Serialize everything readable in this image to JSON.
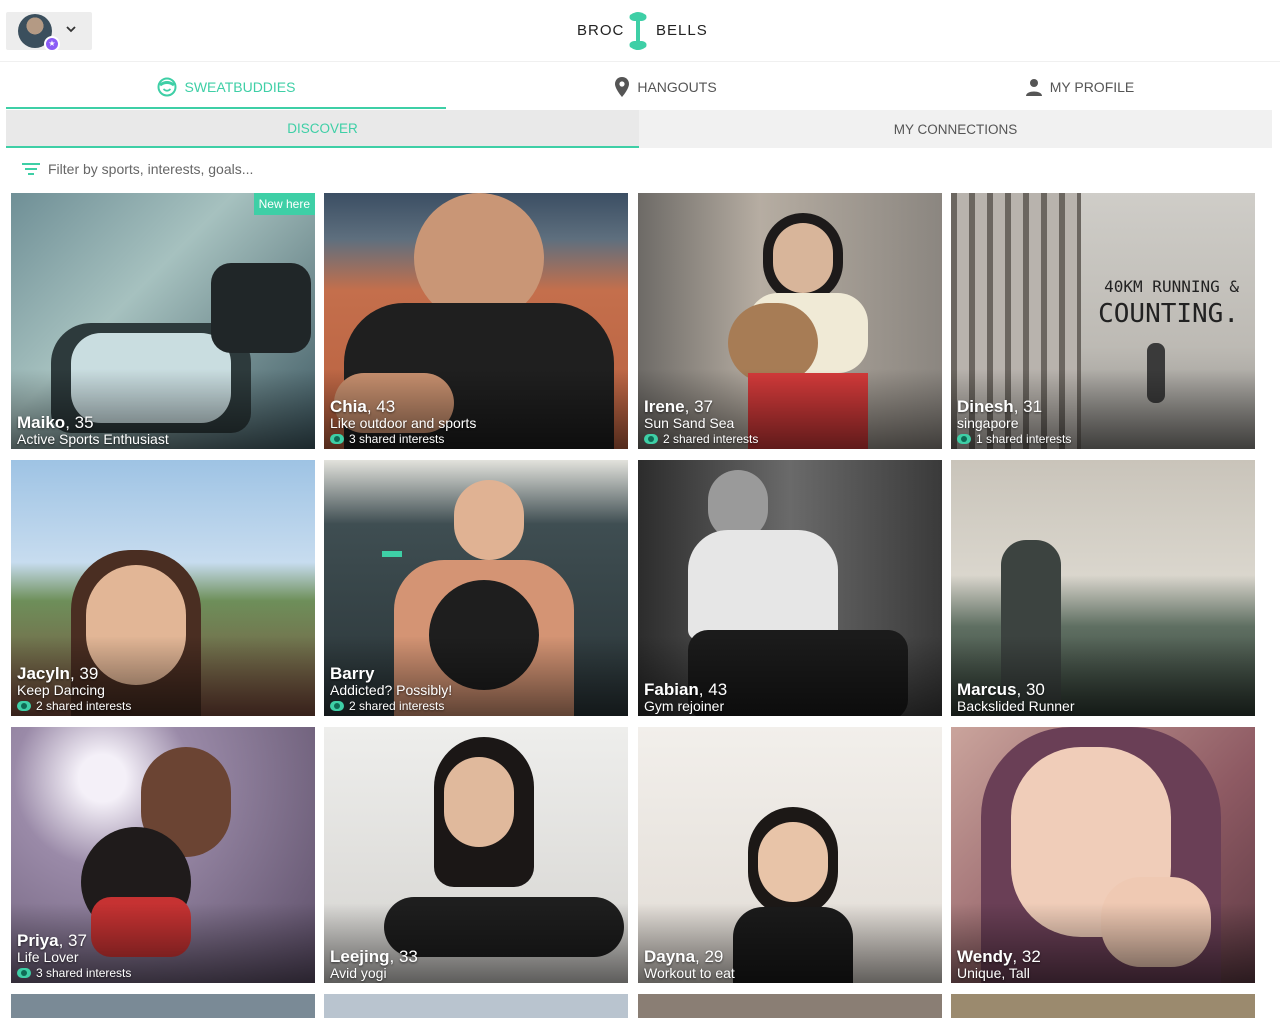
{
  "brand": {
    "left": "BROC",
    "right": "BELLS",
    "accent": "#3ecfa6"
  },
  "header": {
    "avatar_icon": "user-avatar",
    "menu_icon": "chevron-down-icon"
  },
  "tabs": [
    {
      "label": "SWEATBUDDIES",
      "icon": "smiley-icon",
      "active": true
    },
    {
      "label": "HANGOUTS",
      "icon": "map-pin-icon",
      "active": false
    },
    {
      "label": "MY PROFILE",
      "icon": "person-icon",
      "active": false
    }
  ],
  "subtabs": [
    {
      "label": "DISCOVER",
      "active": true
    },
    {
      "label": "MY CONNECTIONS",
      "active": false
    }
  ],
  "filter": {
    "placeholder": "Filter by sports, interests, goals...",
    "icon": "filter-icon"
  },
  "cards": [
    {
      "name": "Maiko",
      "age": ", 35",
      "tagline": "Active Sports Enthusiast",
      "shared": "",
      "badge": "New here",
      "bg": "#8aa7a4"
    },
    {
      "name": "Chia",
      "age": ", 43",
      "tagline": "Like outdoor and sports",
      "shared": "3 shared interests",
      "badge": "",
      "bg": "#a86a4a"
    },
    {
      "name": "Irene",
      "age": ", 37",
      "tagline": "Sun Sand Sea",
      "shared": "2 shared interests",
      "badge": "",
      "bg": "#8c8378"
    },
    {
      "name": "Dinesh",
      "age": ", 31",
      "tagline": "singapore",
      "shared": "1 shared interests",
      "badge": "",
      "bg": "#c8c6c1",
      "poster_line1": "40KM RUNNING &",
      "poster_line2": "COUNTING."
    },
    {
      "name": "Jacyln",
      "age": ", 39",
      "tagline": "Keep Dancing",
      "shared": "2 shared interests",
      "badge": "",
      "bg": "#7b9cb3"
    },
    {
      "name": "Barry",
      "age": "",
      "tagline": "Addicted? Possibly!",
      "shared": "2 shared interests",
      "badge": "",
      "bg": "#4a5a5e"
    },
    {
      "name": "Fabian",
      "age": ", 43",
      "tagline": "Gym rejoiner",
      "shared": "",
      "badge": "",
      "bg": "#5c5c5c"
    },
    {
      "name": "Marcus",
      "age": ", 30",
      "tagline": "Backslided Runner",
      "shared": "",
      "badge": "",
      "bg": "#8f9a8f"
    },
    {
      "name": "Priya",
      "age": ", 37",
      "tagline": "Life Lover",
      "shared": "3 shared interests",
      "badge": "",
      "bg": "#9a8aa8"
    },
    {
      "name": "Leejing",
      "age": ", 33",
      "tagline": "Avid yogi",
      "shared": "",
      "badge": "",
      "bg": "#d8d6d3"
    },
    {
      "name": "Dayna",
      "age": ", 29",
      "tagline": "Workout to eat",
      "shared": "",
      "badge": "",
      "bg": "#e8e4e0"
    },
    {
      "name": "Wendy",
      "age": ", 32",
      "tagline": "Unique, Tall",
      "shared": "",
      "badge": "",
      "bg": "#a56f6a"
    }
  ],
  "next_row_bgs": [
    "#7a8a96",
    "#b9c4cf",
    "#8a7e74",
    "#9b8a6e"
  ]
}
